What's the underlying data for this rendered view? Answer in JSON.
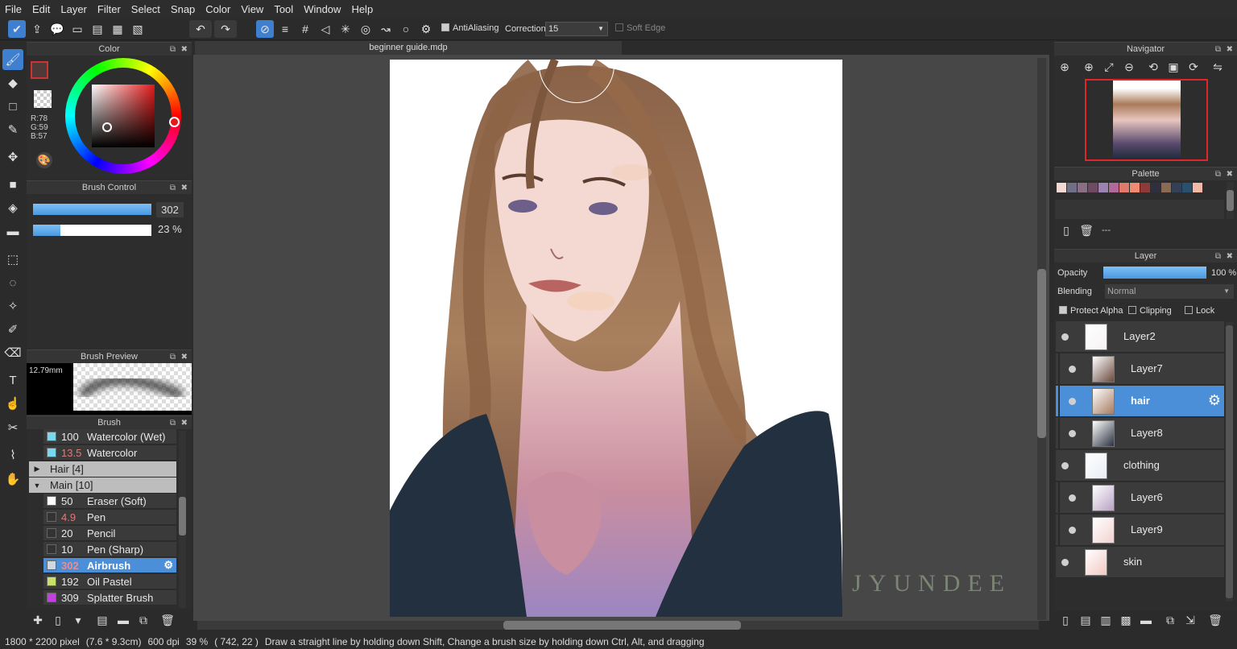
{
  "menu": [
    "File",
    "Edit",
    "Layer",
    "Filter",
    "Select",
    "Snap",
    "Color",
    "View",
    "Tool",
    "Window",
    "Help"
  ],
  "toolbar": {
    "antialiasing_label": "AntiAliasing",
    "correction_label": "Correction",
    "correction_value": "15",
    "soft_edge_label": "Soft Edge"
  },
  "document_tab": "beginner guide.mdp",
  "color_panel": {
    "title": "Color",
    "r": "R:78",
    "g": "G:59",
    "b": "B:57",
    "current_color": "#4e3b39"
  },
  "brush_control": {
    "title": "Brush Control",
    "size_value": "302",
    "opacity_value": "23 %",
    "opacity_fraction": 0.23
  },
  "brush_preview": {
    "title": "Brush Preview",
    "size_label": "12.79mm"
  },
  "brush_panel": {
    "title": "Brush",
    "rows": [
      {
        "size": "100",
        "name": "Watercolor (Wet)",
        "swatch": "#7ad7f0",
        "size_color": "#e8e8e8"
      },
      {
        "size": "13.5",
        "name": "Watercolor",
        "swatch": "#7ad7f0",
        "size_color": "#e07a7a"
      }
    ],
    "groups": [
      {
        "arrow": "▶",
        "name": "Hair [4]"
      },
      {
        "arrow": "▼",
        "name": "Main [10]"
      }
    ],
    "main_rows": [
      {
        "size": "50",
        "name": "Eraser (Soft)",
        "swatch": "#ffffff",
        "size_color": "#e8e8e8"
      },
      {
        "size": "4.9",
        "name": "Pen",
        "swatch": "#333333",
        "size_color": "#e07a7a"
      },
      {
        "size": "20",
        "name": "Pencil",
        "swatch": "#333333",
        "size_color": "#e8e8e8"
      },
      {
        "size": "10",
        "name": "Pen (Sharp)",
        "swatch": "#333333",
        "size_color": "#e8e8e8"
      },
      {
        "size": "302",
        "name": "Airbrush",
        "swatch": "#cfd8e0",
        "size_color": "#f28b8b"
      },
      {
        "size": "192",
        "name": "Oil Pastel",
        "swatch": "#c7e06a",
        "size_color": "#e8e8e8"
      },
      {
        "size": "309",
        "name": "Splatter Brush",
        "swatch": "#c43ee0",
        "size_color": "#e8e8e8"
      }
    ]
  },
  "navigator": {
    "title": "Navigator"
  },
  "palette": {
    "title": "Palette",
    "swatches": [
      "#f3d9d6",
      "#6f6f85",
      "#8a6f82",
      "#704a62",
      "#9b85b0",
      "#b06a9a",
      "#e07a6a",
      "#f08a70",
      "#8f3a3a",
      "#2f2f40",
      "#8a6a55",
      "#334055",
      "#2a5070",
      "#f2b9a6"
    ],
    "name": "---"
  },
  "layer_panel": {
    "title": "Layer",
    "opacity_label": "Opacity",
    "opacity_value": "100 %",
    "blending_label": "Blending",
    "blending_value": "Normal",
    "protect_alpha": "Protect Alpha",
    "clipping": "Clipping",
    "lock": "Lock",
    "layers": [
      {
        "name": "Layer2",
        "indent": 0,
        "selected": false
      },
      {
        "name": "Layer7",
        "indent": 1,
        "selected": false
      },
      {
        "name": "hair",
        "indent": 1,
        "selected": true
      },
      {
        "name": "Layer8",
        "indent": 1,
        "selected": false
      },
      {
        "name": "clothing",
        "indent": 0,
        "selected": false
      },
      {
        "name": "Layer6",
        "indent": 1,
        "selected": false
      },
      {
        "name": "Layer9",
        "indent": 1,
        "selected": false
      },
      {
        "name": "skin",
        "indent": 0,
        "selected": false
      }
    ]
  },
  "watermark": "JYUNDEE",
  "status": {
    "pixels": "1800 * 2200 pixel",
    "cm": "(7.6 * 9.3cm)",
    "dpi": "600 dpi",
    "zoom": "39 %",
    "coords": "( 742, 22 )",
    "hint": "Draw a straight line by holding down Shift, Change a brush size by holding down Ctrl, Alt, and dragging"
  }
}
